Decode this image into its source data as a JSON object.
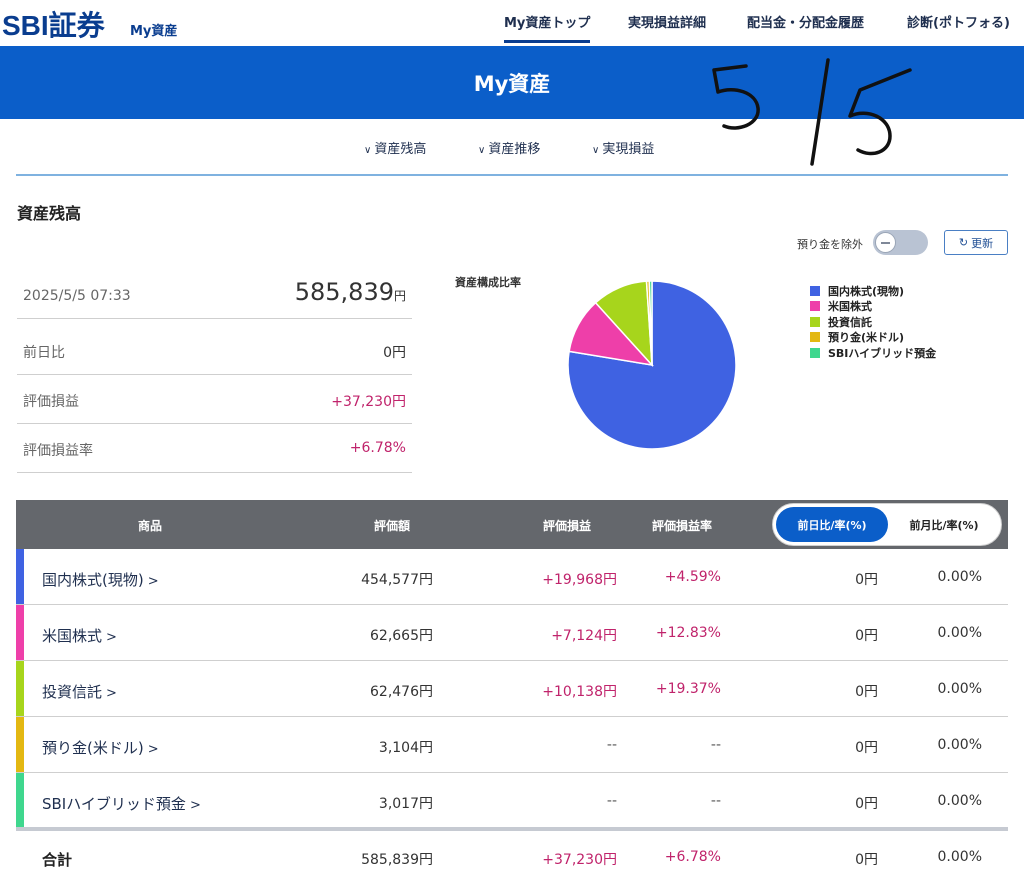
{
  "header": {
    "logo": "SBI証券",
    "logo_sub": "My資産",
    "nav": [
      "My資産トップ",
      "実現損益詳細",
      "配当金・分配金履歴",
      "診断(ポトフォる)"
    ],
    "banner_title": "My資産"
  },
  "handwritten_note": "5/5",
  "subnav": [
    "資産残高",
    "資産推移",
    "実現損益"
  ],
  "section_title": "資産残高",
  "controls": {
    "toggle_label": "預り金を除外",
    "toggle_on": false,
    "refresh_label": "更新"
  },
  "summary": {
    "date": "2025/5/5 07:33",
    "total_value": "585,839",
    "yen": "円",
    "rows": [
      {
        "label": "前日比",
        "value": "0円"
      },
      {
        "label": "評価損益",
        "value": "+37,230円"
      },
      {
        "label": "評価損益率",
        "value": "+6.78%"
      }
    ]
  },
  "pie": {
    "title": "資産構成比率",
    "slices": [
      {
        "label": "国内株式(現物)",
        "value": 454577,
        "color": "#3f62e2"
      },
      {
        "label": "米国株式",
        "value": 62665,
        "color": "#ee3fa9"
      },
      {
        "label": "投資信託",
        "value": 62476,
        "color": "#a7d51c"
      },
      {
        "label": "預り金(米ドル)",
        "value": 3104,
        "color": "#e3b812"
      },
      {
        "label": "SBIハイブリッド預金",
        "value": 3017,
        "color": "#3fd78e"
      }
    ]
  },
  "table": {
    "headers": [
      "商品",
      "評価額",
      "評価損益",
      "評価損益率"
    ],
    "tabs": [
      "前日比/率(%)",
      "前月比/率(%)"
    ],
    "active_tab": 0,
    "rows": [
      {
        "name": "国内株式(現物)",
        "value": "454,577円",
        "pl": "+19,968円",
        "pl_rate": "+4.59%",
        "day": "0円",
        "day_rate": "0.00%",
        "color": "#3f62e2"
      },
      {
        "name": "米国株式",
        "value": "62,665円",
        "pl": "+7,124円",
        "pl_rate": "+12.83%",
        "day": "0円",
        "day_rate": "0.00%",
        "color": "#ee3fa9"
      },
      {
        "name": "投資信託",
        "value": "62,476円",
        "pl": "+10,138円",
        "pl_rate": "+19.37%",
        "day": "0円",
        "day_rate": "0.00%",
        "color": "#a7d51c"
      },
      {
        "name": "預り金(米ドル)",
        "value": "3,104円",
        "pl": "--",
        "pl_rate": "--",
        "day": "0円",
        "day_rate": "0.00%",
        "color": "#e3b812"
      },
      {
        "name": "SBIハイブリッド預金",
        "value": "3,017円",
        "pl": "--",
        "pl_rate": "--",
        "day": "0円",
        "day_rate": "0.00%",
        "color": "#3fd78e"
      }
    ],
    "total": {
      "name": "合計",
      "value": "585,839円",
      "pl": "+37,230円",
      "pl_rate": "+6.78%",
      "day": "0円",
      "day_rate": "0.00%"
    }
  },
  "colors": {
    "brand": "#0a3d8f",
    "banner": "#0b5ec9",
    "positive": "#c0236b"
  }
}
